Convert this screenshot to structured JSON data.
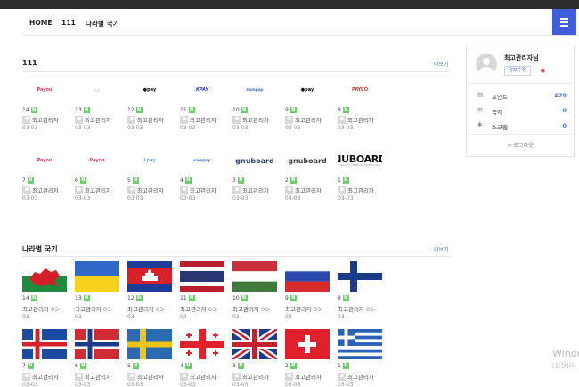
{
  "nav": {
    "items": [
      "HOME",
      "111",
      "나라별 국기"
    ]
  },
  "section1": {
    "title": "111",
    "more": "더보기",
    "rows": [
      [
        {
          "num": "14",
          "label": "Payou",
          "style": "pink",
          "author": "최고관리자",
          "date": "03-03"
        },
        {
          "num": "13",
          "label": "▭",
          "style": "gray",
          "author": "최고관리자",
          "date": "03-03"
        },
        {
          "num": "12",
          "label": "●pay",
          "style": "black",
          "author": "최고관리자",
          "date": "03-03"
        },
        {
          "num": "11",
          "label": "KPAY",
          "style": "blue",
          "author": "최고관리자",
          "date": "03-03"
        },
        {
          "num": "10",
          "label": "sampay",
          "style": "blueitalic",
          "author": "최고관리자",
          "date": "03-03"
        },
        {
          "num": "9",
          "label": "●pay",
          "style": "black",
          "author": "최고관리자",
          "date": "03-03"
        },
        {
          "num": "8",
          "label": "PAYCO",
          "style": "red",
          "author": "최고관리자",
          "date": "03-03"
        }
      ],
      [
        {
          "num": "7",
          "label": "Payou",
          "style": "pink",
          "author": "최고관리자",
          "date": "03-03"
        },
        {
          "num": "6",
          "label": "Payou",
          "style": "pink",
          "author": "최고관리자",
          "date": "03-03"
        },
        {
          "num": "5",
          "label": "Lpay",
          "style": "lightblue",
          "author": "최고관리자",
          "date": "03-03"
        },
        {
          "num": "4",
          "label": "sampay",
          "style": "blueitalic",
          "author": "최고관리자",
          "date": "03-03"
        },
        {
          "num": "3",
          "label": "gnuboard",
          "style": "gnublue",
          "author": "최고관리자",
          "date": "03-03"
        },
        {
          "num": "2",
          "label": "gnuboard",
          "style": "gnugray",
          "author": "최고관리자",
          "date": "03-03"
        },
        {
          "num": "1",
          "label": "NUBOARD",
          "sub": "ultimate WEBFORUM/BBS www",
          "style": "big",
          "author": "최고관리자",
          "date": "03-03"
        }
      ]
    ]
  },
  "section2": {
    "title": "나라별 국기",
    "more": "더보기",
    "rows": [
      [
        {
          "num": "14",
          "flag": "wales",
          "author": "최고관리자",
          "date": "03-",
          "date2": "03"
        },
        {
          "num": "13",
          "flag": "ukraine",
          "author": "최고관리자",
          "date": "03-",
          "date2": "03"
        },
        {
          "num": "12",
          "flag": "cambodia",
          "author": "최고관리자",
          "date": "03-",
          "date2": "03"
        },
        {
          "num": "11",
          "flag": "thailand",
          "author": "최고관리자",
          "date": "03-",
          "date2": "03"
        },
        {
          "num": "10",
          "flag": "hungary",
          "author": "최고관리자",
          "date": "03-",
          "date2": "03"
        },
        {
          "num": "9",
          "flag": "russia",
          "author": "최고관리자",
          "date": "03-",
          "date2": "03"
        },
        {
          "num": "8",
          "flag": "finland",
          "author": "최고관리자",
          "date": "03-",
          "date2": "03"
        }
      ],
      [
        {
          "num": "7",
          "flag": "iceland",
          "author": "최고관리자",
          "date": "03-03"
        },
        {
          "num": "6",
          "flag": "norway",
          "author": "최고관리자",
          "date": "03-03"
        },
        {
          "num": "5",
          "flag": "sweden",
          "author": "최고관리자",
          "date": "03-03"
        },
        {
          "num": "4",
          "flag": "georgia",
          "author": "최고관리자",
          "date": "03-03"
        },
        {
          "num": "3",
          "flag": "uk",
          "author": "최고관리자",
          "date": "03-03"
        },
        {
          "num": "2",
          "flag": "switzerland",
          "author": "최고관리자",
          "date": "03-03"
        },
        {
          "num": "1",
          "flag": "greece",
          "author": "최고관리자",
          "date": "03-03"
        }
      ]
    ]
  },
  "profile": {
    "name": "최고관리자님",
    "edit": "정보수정",
    "rows": [
      {
        "icon": "▤",
        "iconName": "point-icon",
        "label": "포인트",
        "value": "270"
      },
      {
        "icon": "✉",
        "iconName": "note-icon",
        "label": "쪽지",
        "value": "0"
      },
      {
        "icon": "✱",
        "iconName": "scrap-icon",
        "label": "스크랩",
        "value": "0"
      }
    ],
    "logout": "⇦ 로그아웃"
  },
  "badge": "N",
  "watermark": {
    "line1": "Windo",
    "line2": "[설정]으"
  },
  "colors": {
    "accent": "#3f5ed8",
    "badge": "#6ad069",
    "link": "#3f7ad8"
  }
}
